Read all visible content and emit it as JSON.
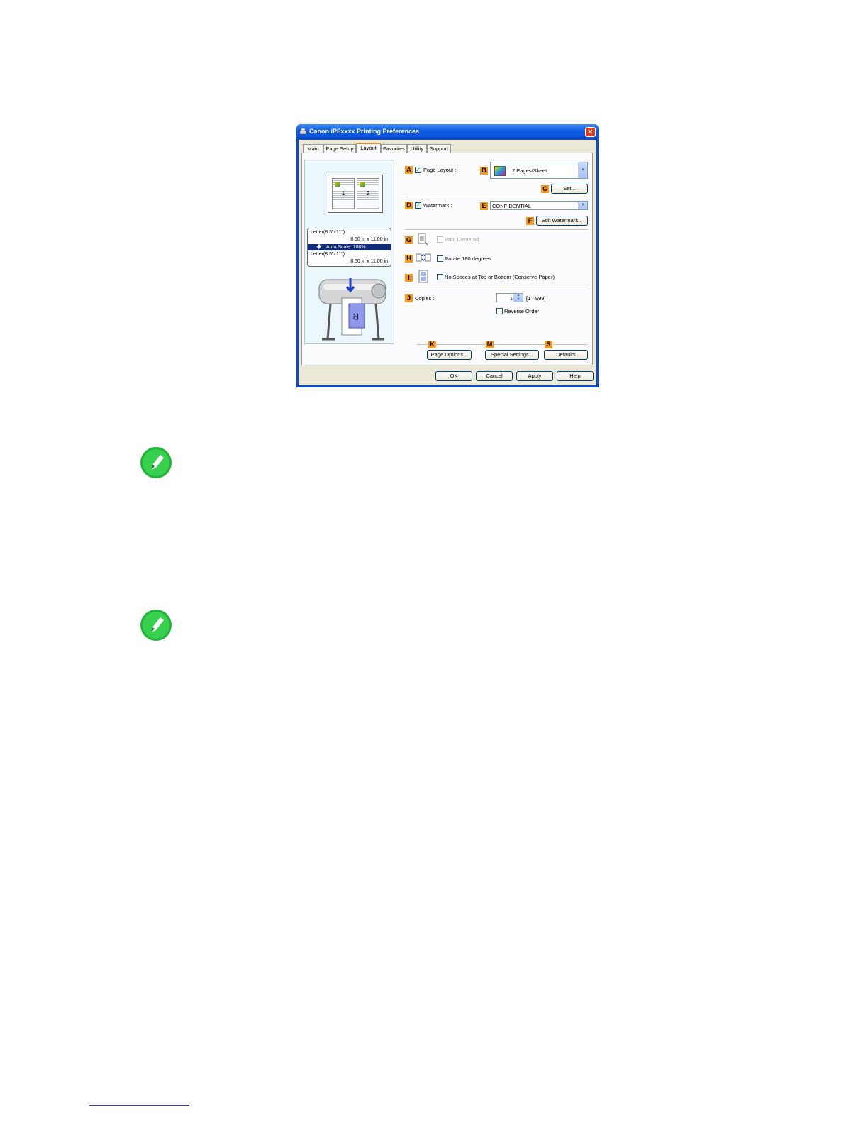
{
  "window": {
    "title": "Canon iPFxxxx Printing Preferences",
    "close_glyph": "✕"
  },
  "tabs": [
    {
      "label": "Main"
    },
    {
      "label": "Page Setup"
    },
    {
      "label": "Layout"
    },
    {
      "label": "Favorites"
    },
    {
      "label": "Utility"
    },
    {
      "label": "Support"
    }
  ],
  "preview": {
    "page1": "1",
    "page2": "2",
    "input_size": "Letter(8.5\"x11\") :",
    "input_dims": "8.50 in x 11.00 in",
    "scale": "Auto Scale: 100%",
    "output_size": "Letter(8.5\"x11\") :",
    "output_dims": "8.50 in x 11.00 in",
    "arrow_glyph": "🡇"
  },
  "controls": {
    "page_layout": {
      "badge": "A",
      "label": "Page Layout :",
      "checked": true
    },
    "layout_select": {
      "badge": "B",
      "value": "2 Pages/Sheet"
    },
    "set_button": {
      "badge": "C",
      "label": "Set..."
    },
    "watermark": {
      "badge": "D",
      "label": "Watermark :",
      "checked": true
    },
    "watermark_select": {
      "badge": "E",
      "value": "CONFIDENTIAL"
    },
    "edit_watermark": {
      "badge": "F",
      "label": "Edit Watermark..."
    },
    "print_centered": {
      "badge": "G",
      "label": "Print Centered"
    },
    "rotate": {
      "badge": "H",
      "label": "Rotate 180 degrees"
    },
    "no_spaces": {
      "badge": "I",
      "label": "No Spaces at Top or Bottom (Conserve Paper)"
    },
    "copies": {
      "badge": "J",
      "label": "Copies :",
      "value": "1",
      "range": "[1 - 999]"
    },
    "reverse_order": {
      "label": "Reverse Order"
    },
    "page_options": {
      "badge": "K",
      "label": "Page Options..."
    },
    "special_settings": {
      "badge": "M",
      "label": "Special Settings..."
    },
    "defaults": {
      "badge": "S",
      "label": "Defaults"
    }
  },
  "footer_buttons": {
    "ok": "OK",
    "cancel": "Cancel",
    "apply": "Apply",
    "help": "Help"
  },
  "colors": {
    "title_bar": "#0a4bd6",
    "badge": "#f39a1d",
    "note_icon": "#22b33a"
  },
  "icons": {
    "note": "pencil-note-icon"
  }
}
